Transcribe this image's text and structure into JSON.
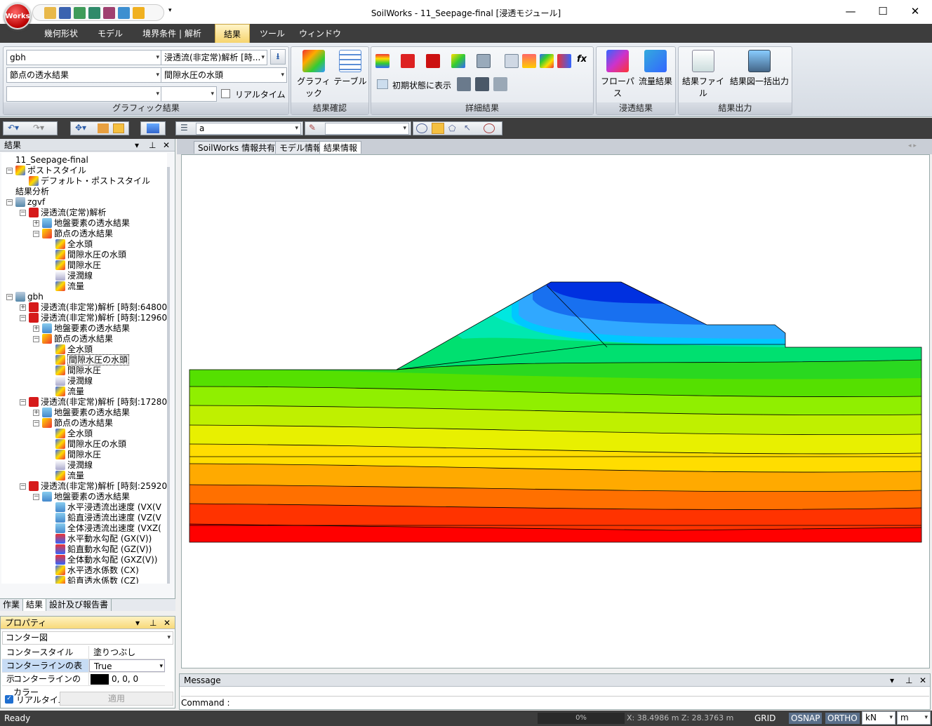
{
  "window": {
    "title": "SoilWorks - 11_Seepage-final [浸透モジュール]",
    "logo_text": "Works"
  },
  "menu": {
    "tabs": [
      {
        "label": "幾何形状"
      },
      {
        "label": "モデル"
      },
      {
        "label": "境界条件 | 解析"
      },
      {
        "label": "結果"
      },
      {
        "label": "ツール"
      },
      {
        "label": "ウィンドウ"
      }
    ],
    "active": "結果"
  },
  "ribbon": {
    "graphic": {
      "combo1": "gbh",
      "combo2": "浸透流(非定常)解析 [時...",
      "combo3": "節点の透水結果",
      "combo4": "間隙水圧の水頭",
      "combo5": "",
      "combo6": "",
      "realtime_label": "リアルタイム",
      "group_label": "グラフィック結果"
    },
    "check": {
      "graphic": "グラフィック",
      "table": "テーブル",
      "group_label": "結果確認"
    },
    "detail": {
      "initial_state": "初期状態に表示",
      "fx": "fx",
      "group_label": "詳細結果"
    },
    "seepage": {
      "flowpath": "フローパス",
      "flow_result": "流量結果",
      "group_label": "浸透結果"
    },
    "output": {
      "result_file": "結果ファイル",
      "batch_output": "結果図一括出力",
      "group_label": "結果出力"
    }
  },
  "toolbar2": {
    "layer_value": "a",
    "filter_value": ""
  },
  "result_panel": {
    "title": "結果",
    "tree": [
      {
        "label": "11_Seepage-final",
        "level": 0,
        "exp": "",
        "icon": ""
      },
      {
        "label": "ポストスタイル",
        "level": 0,
        "exp": "-",
        "icon": "style"
      },
      {
        "label": "デフォルト・ポストスタイル",
        "level": 1,
        "exp": "",
        "icon": "style"
      },
      {
        "label": "結果分析",
        "level": 0,
        "exp": "",
        "icon": ""
      },
      {
        "label": "zgvf",
        "level": 0,
        "exp": "-",
        "icon": "analysis"
      },
      {
        "label": "浸透流(定常)解析",
        "level": 1,
        "exp": "-",
        "icon": "case"
      },
      {
        "label": "地盤要素の透水結果",
        "level": 2,
        "exp": "+",
        "icon": "element"
      },
      {
        "label": "節点の透水結果",
        "level": 2,
        "exp": "-",
        "icon": "node"
      },
      {
        "label": "全水頭",
        "level": 3,
        "exp": "",
        "icon": "contour"
      },
      {
        "label": "間隙水圧の水頭",
        "level": 3,
        "exp": "",
        "icon": "contour"
      },
      {
        "label": "間隙水圧",
        "level": 3,
        "exp": "",
        "icon": "contour"
      },
      {
        "label": "浸潤線",
        "level": 3,
        "exp": "",
        "icon": "line"
      },
      {
        "label": "流量",
        "level": 3,
        "exp": "",
        "icon": "contour"
      },
      {
        "label": "gbh",
        "level": 0,
        "exp": "-",
        "icon": "analysis"
      },
      {
        "label": "浸透流(非定常)解析 [時刻:64800",
        "level": 1,
        "exp": "+",
        "icon": "case"
      },
      {
        "label": "浸透流(非定常)解析 [時刻:12960",
        "level": 1,
        "exp": "-",
        "icon": "case"
      },
      {
        "label": "地盤要素の透水結果",
        "level": 2,
        "exp": "+",
        "icon": "element"
      },
      {
        "label": "節点の透水結果",
        "level": 2,
        "exp": "-",
        "icon": "node"
      },
      {
        "label": "全水頭",
        "level": 3,
        "exp": "",
        "icon": "contour"
      },
      {
        "label": "間隙水圧の水頭",
        "level": 3,
        "exp": "",
        "icon": "contour",
        "selected": true
      },
      {
        "label": "間隙水圧",
        "level": 3,
        "exp": "",
        "icon": "contour"
      },
      {
        "label": "浸潤線",
        "level": 3,
        "exp": "",
        "icon": "line"
      },
      {
        "label": "流量",
        "level": 3,
        "exp": "",
        "icon": "contour"
      },
      {
        "label": "浸透流(非定常)解析 [時刻:17280",
        "level": 1,
        "exp": "-",
        "icon": "case"
      },
      {
        "label": "地盤要素の透水結果",
        "level": 2,
        "exp": "+",
        "icon": "element"
      },
      {
        "label": "節点の透水結果",
        "level": 2,
        "exp": "-",
        "icon": "node"
      },
      {
        "label": "全水頭",
        "level": 3,
        "exp": "",
        "icon": "contour"
      },
      {
        "label": "間隙水圧の水頭",
        "level": 3,
        "exp": "",
        "icon": "contour"
      },
      {
        "label": "間隙水圧",
        "level": 3,
        "exp": "",
        "icon": "contour"
      },
      {
        "label": "浸潤線",
        "level": 3,
        "exp": "",
        "icon": "line"
      },
      {
        "label": "流量",
        "level": 3,
        "exp": "",
        "icon": "contour"
      },
      {
        "label": "浸透流(非定常)解析 [時刻:25920",
        "level": 1,
        "exp": "-",
        "icon": "case"
      },
      {
        "label": "地盤要素の透水結果",
        "level": 2,
        "exp": "-",
        "icon": "element"
      },
      {
        "label": "水平浸透流出速度 (VX(V",
        "level": 3,
        "exp": "",
        "icon": "element"
      },
      {
        "label": "鉛直浸透流出速度 (VZ(V",
        "level": 3,
        "exp": "",
        "icon": "element"
      },
      {
        "label": "全体浸透流出速度 (VXZ(",
        "level": 3,
        "exp": "",
        "icon": "element"
      },
      {
        "label": "水平動水勾配 (GX(V))",
        "level": 3,
        "exp": "",
        "icon": "gradient"
      },
      {
        "label": "鉛直動水勾配 (GZ(V))",
        "level": 3,
        "exp": "",
        "icon": "gradient"
      },
      {
        "label": "全体動水勾配 (GXZ(V))",
        "level": 3,
        "exp": "",
        "icon": "gradient"
      },
      {
        "label": "水平透水係数 (CX)",
        "level": 3,
        "exp": "",
        "icon": "contour"
      },
      {
        "label": "鉛直透水係数 (CZ)",
        "level": 3,
        "exp": "",
        "icon": "contour"
      }
    ],
    "bottom_tabs": [
      {
        "label": "作業"
      },
      {
        "label": "結果"
      },
      {
        "label": "設計及び報告書"
      }
    ]
  },
  "properties": {
    "title": "プロパティ",
    "selector": "コンター図",
    "rows": [
      {
        "key": "コンタースタイル",
        "value": "塗りつぶし"
      },
      {
        "key": "コンターラインの表示",
        "value": "True"
      },
      {
        "key": "コンターラインのカラー",
        "value": "0, 0, 0"
      }
    ],
    "realtime": "リアルタイム",
    "apply": "適用"
  },
  "doc_tabs": [
    {
      "label": "SoilWorks 情報共有"
    },
    {
      "label": "モデル情報"
    },
    {
      "label": "結果情報"
    }
  ],
  "message": {
    "title": "Message",
    "command_label": "Command :"
  },
  "status": {
    "ready": "Ready",
    "percent": "0%",
    "coords": "X: 38.4986 m  Z: 28.3763 m",
    "grid": "GRID",
    "osnap": "OSNAP",
    "ortho": "ORTHO",
    "force_unit": "kN",
    "length_unit": "m"
  },
  "colors": {
    "chrome_dark": "#3d3d3d",
    "active_tab": "#f6d46e",
    "contour_high": "#ff0000",
    "contour_low": "#0000e0"
  }
}
